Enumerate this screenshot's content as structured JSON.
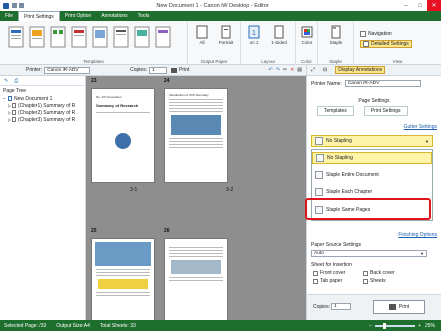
{
  "window": {
    "title": "New Document 1 - Canon iW Desktop - Editor",
    "minimize": "–",
    "maximize": "□",
    "close": "✕"
  },
  "tabs": [
    "File",
    "Print Settings",
    "Print Option",
    "Annotations",
    "Tools"
  ],
  "ribbon": {
    "groups": {
      "templates": "Templates",
      "output_paper": "Output Paper",
      "layout": "Layout",
      "color": "Color",
      "staple": "Staple",
      "view": "View"
    },
    "buttons": {
      "all": "All",
      "portrait": "Portrait",
      "on1": "on 1",
      "one_sided": "1-Sided",
      "color": "Color",
      "staple": "Staple",
      "navigation": "Navigation",
      "detailed": "Detailed Settings",
      "display_annotations": "Display Annotations"
    }
  },
  "printer_row": {
    "printer_label": "Printer:",
    "printer_value": "Canon iR-ADV",
    "copies_label": "Copies:",
    "copies_value": "1",
    "print_label": "Print"
  },
  "left": {
    "title": "Page Tree",
    "items": [
      "New Document 1",
      "(Chapter1) Summary of R",
      "(Chapter2) Summary of R",
      "(Chapter3) Summary of R"
    ]
  },
  "pages": {
    "top_left_num": "23",
    "top_right_num": "24",
    "bottom_left_num": "25",
    "bottom_right_num": "26",
    "label_a": "3-1",
    "label_b": "3-2",
    "p1_head": "No. XX Convention",
    "p1_title": "Summary of Research",
    "p2_head": "Introduction of XXX Summary"
  },
  "right": {
    "printer_name_label": "Printer Name:",
    "printer_name_value": "Canon iR-ADV",
    "page_settings": "Page Settings",
    "tab_templates": "Templates",
    "tab_print_settings": "Print Settings",
    "gutter_link": "Gutter Settings",
    "dropdown_value": "No Stapling",
    "options": [
      "No Stapling",
      "Staple Entire Document",
      "Staple Each Chapter",
      "Staple Same Pages"
    ],
    "finishing_link": "Finishing Options",
    "paper_source_label": "Paper Source Settings",
    "paper_source_value": "Auto",
    "sheet_insertion_label": "Sheet for Insertion",
    "front_cover": "Front cover",
    "back_cover": "Back cover",
    "tab_paper": "Tab paper",
    "sheets": "Sheets",
    "copies_label": "Copies:",
    "copies_value": "1",
    "print_button": "Print"
  },
  "status": {
    "selected": "Selected Page: /33",
    "output_size": "Output Size:A4",
    "total": "Total Sheets: 33",
    "zoom": "25%"
  },
  "colors": {
    "accent_green": "#1e6e2e",
    "highlight_yellow": "#fff3a8",
    "annotation_red": "#e0141e"
  }
}
